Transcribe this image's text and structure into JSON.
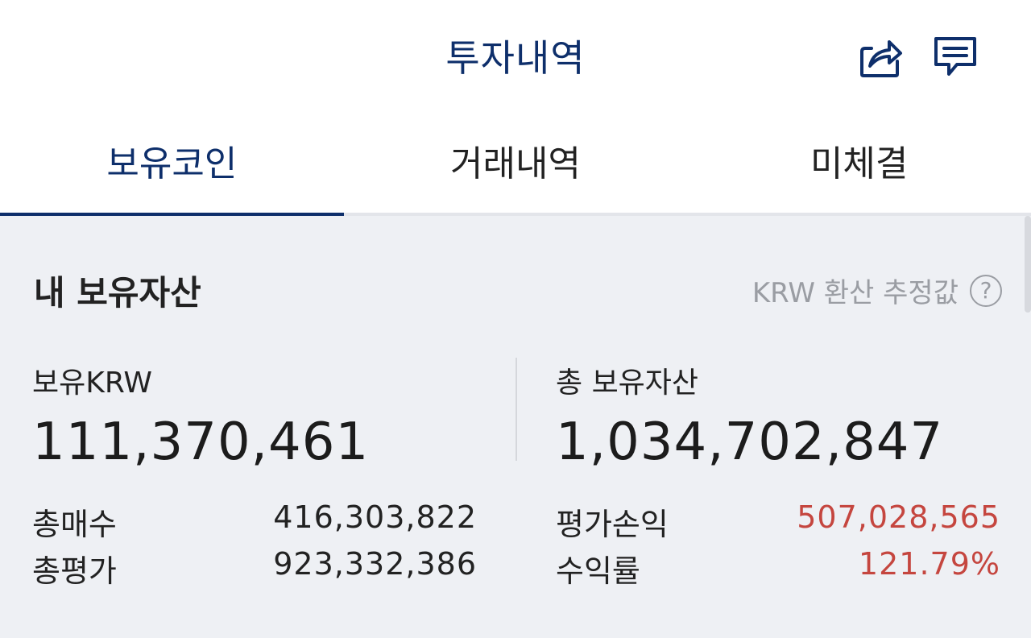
{
  "header": {
    "title": "투자내역"
  },
  "tabs": [
    {
      "label": "보유코인",
      "active": true
    },
    {
      "label": "거래내역",
      "active": false
    },
    {
      "label": "미체결",
      "active": false
    }
  ],
  "assets": {
    "title": "내 보유자산",
    "krw_note": "KRW 환산 추정값",
    "help_symbol": "?",
    "holding_krw_label": "보유KRW",
    "holding_krw_value": "111,370,461",
    "total_assets_label": "총 보유자산",
    "total_assets_value": "1,034,702,847",
    "total_buy_label": "총매수",
    "total_buy_value": "416,303,822",
    "total_eval_label": "총평가",
    "total_eval_value": "923,332,386",
    "pnl_label": "평가손익",
    "pnl_value": "507,028,565",
    "return_label": "수익률",
    "return_value": "121.79%"
  },
  "colors": {
    "accent": "#0e2f6b",
    "positive": "#c5463f",
    "background": "#eef0f4"
  },
  "icons": {
    "share": "share-icon",
    "chat": "chat-icon",
    "help": "help-icon"
  }
}
